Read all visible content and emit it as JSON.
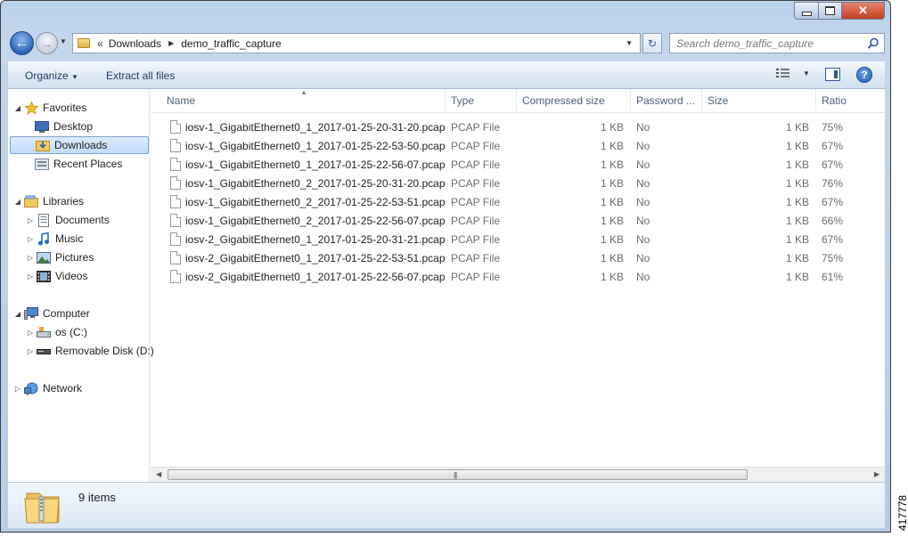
{
  "window": {
    "controls": {
      "minimize": "minimize",
      "maximize": "maximize",
      "close": "✕"
    }
  },
  "address": {
    "overflow": "«",
    "crumbs": [
      "Downloads",
      "demo_traffic_capture"
    ]
  },
  "search": {
    "placeholder": "Search demo_traffic_capture"
  },
  "toolbar": {
    "organize": "Organize",
    "extract": "Extract all files"
  },
  "nav": {
    "favorites": "Favorites",
    "desktop": "Desktop",
    "downloads": "Downloads",
    "recent": "Recent Places",
    "libraries": "Libraries",
    "documents": "Documents",
    "music": "Music",
    "pictures": "Pictures",
    "videos": "Videos",
    "computer": "Computer",
    "os": "os (C:)",
    "removable": "Removable Disk (D:)",
    "network": "Network"
  },
  "columns": {
    "name": "Name",
    "type": "Type",
    "compressed": "Compressed size",
    "password": "Password ...",
    "size": "Size",
    "ratio": "Ratio"
  },
  "files": [
    {
      "name": "iosv-1_GigabitEthernet0_1_2017-01-25-20-31-20.pcap",
      "type": "PCAP File",
      "compressed": "1 KB",
      "password": "No",
      "size": "1 KB",
      "ratio": "75%"
    },
    {
      "name": "iosv-1_GigabitEthernet0_1_2017-01-25-22-53-50.pcap",
      "type": "PCAP File",
      "compressed": "1 KB",
      "password": "No",
      "size": "1 KB",
      "ratio": "67%"
    },
    {
      "name": "iosv-1_GigabitEthernet0_1_2017-01-25-22-56-07.pcap",
      "type": "PCAP File",
      "compressed": "1 KB",
      "password": "No",
      "size": "1 KB",
      "ratio": "67%"
    },
    {
      "name": "iosv-1_GigabitEthernet0_2_2017-01-25-20-31-20.pcap",
      "type": "PCAP File",
      "compressed": "1 KB",
      "password": "No",
      "size": "1 KB",
      "ratio": "76%"
    },
    {
      "name": "iosv-1_GigabitEthernet0_2_2017-01-25-22-53-51.pcap",
      "type": "PCAP File",
      "compressed": "1 KB",
      "password": "No",
      "size": "1 KB",
      "ratio": "67%"
    },
    {
      "name": "iosv-1_GigabitEthernet0_2_2017-01-25-22-56-07.pcap",
      "type": "PCAP File",
      "compressed": "1 KB",
      "password": "No",
      "size": "1 KB",
      "ratio": "66%"
    },
    {
      "name": "iosv-2_GigabitEthernet0_1_2017-01-25-20-31-21.pcap",
      "type": "PCAP File",
      "compressed": "1 KB",
      "password": "No",
      "size": "1 KB",
      "ratio": "67%"
    },
    {
      "name": "iosv-2_GigabitEthernet0_1_2017-01-25-22-53-51.pcap",
      "type": "PCAP File",
      "compressed": "1 KB",
      "password": "No",
      "size": "1 KB",
      "ratio": "75%"
    },
    {
      "name": "iosv-2_GigabitEthernet0_1_2017-01-25-22-56-07.pcap",
      "type": "PCAP File",
      "compressed": "1 KB",
      "password": "No",
      "size": "1 KB",
      "ratio": "61%"
    }
  ],
  "status": {
    "count": "9 items"
  },
  "figure_code": "417778",
  "colors": {
    "selection": "#c1dcfc",
    "accent": "#2e64b8"
  }
}
